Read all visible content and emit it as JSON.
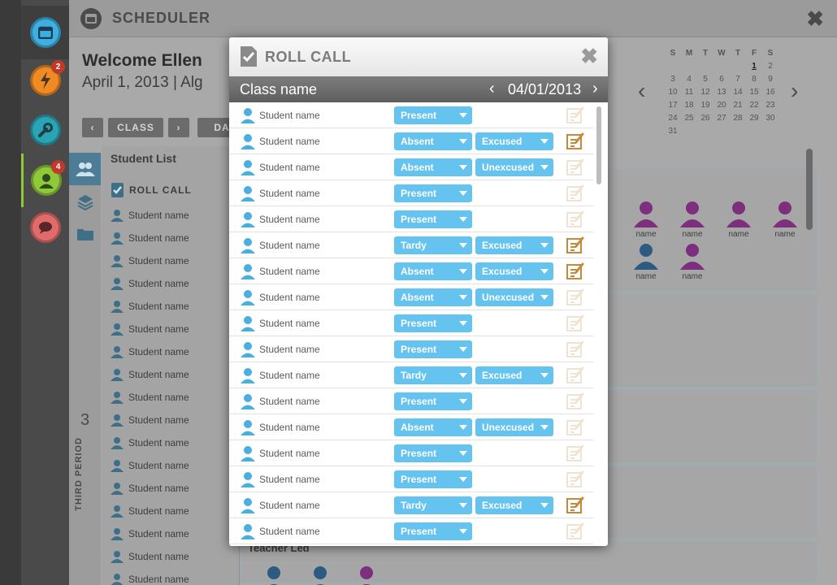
{
  "sidebar": {
    "items": [
      {
        "name": "calendar",
        "color": "#3db0e0",
        "badge": ""
      },
      {
        "name": "alerts",
        "color": "#f08a24",
        "badge": "2"
      },
      {
        "name": "tools",
        "color": "#2aa3b5",
        "badge": ""
      },
      {
        "name": "users",
        "color": "#8fc93a",
        "badge": "4"
      },
      {
        "name": "chat",
        "color": "#e06b6b",
        "badge": ""
      }
    ]
  },
  "app": {
    "title": "SCHEDULER",
    "close": "✖",
    "welcome": "Welcome Ellen",
    "date_line": "April 1, 2013  |  Alg",
    "nav": {
      "prev": "‹",
      "class_label": "CLASS",
      "next": "›",
      "day_label": "DA"
    },
    "period_num": "3",
    "period_text": "THIRD PERIOD",
    "student_list": {
      "title": "Student List",
      "roll_call": "ROLL CALL",
      "items": [
        "Student name",
        "Student name",
        "Student name",
        "Student name",
        "Student name",
        "Student name",
        "Student name",
        "Student name",
        "Student name",
        "Student name",
        "Student name",
        "Student name",
        "Student name",
        "Student name",
        "Student name",
        "Student name",
        "Student name"
      ]
    },
    "calendar": {
      "weekdays": [
        "S",
        "M",
        "T",
        "W",
        "T",
        "F",
        "S"
      ],
      "weeks": [
        [
          "",
          "",
          "",
          "",
          "",
          "1",
          "2"
        ],
        [
          "3",
          "4",
          "5",
          "6",
          "7",
          "8",
          "9"
        ],
        [
          "10",
          "11",
          "12",
          "13",
          "14",
          "15",
          "16"
        ],
        [
          "17",
          "18",
          "19",
          "20",
          "21",
          "22",
          "23"
        ],
        [
          "24",
          "25",
          "26",
          "27",
          "28",
          "29",
          "30"
        ],
        [
          "31",
          "",
          "",
          "",
          "",
          "",
          ""
        ]
      ],
      "prev": "‹",
      "next": "›"
    },
    "grid_names": [
      "name",
      "name",
      "name",
      "name",
      "name",
      "name"
    ],
    "teacher_led": "Teacher Led"
  },
  "modal": {
    "title": "ROLL CALL",
    "close": "✖",
    "class_name": "Class name",
    "date": "04/01/2013",
    "date_prev": "‹",
    "date_next": "›",
    "colors": {
      "dropdown": "#65c3f0",
      "note_active": "#c48a3c",
      "note_inactive": "#f1e2d2",
      "avatar": "#4aaee0"
    },
    "rows": [
      {
        "name": "Student name",
        "status": "Present",
        "reason": "",
        "note_active": false
      },
      {
        "name": "Student name",
        "status": "Absent",
        "reason": "Excused",
        "note_active": true
      },
      {
        "name": "Student name",
        "status": "Absent",
        "reason": "Unexcused",
        "note_active": false
      },
      {
        "name": "Student name",
        "status": "Present",
        "reason": "",
        "note_active": false
      },
      {
        "name": "Student name",
        "status": "Present",
        "reason": "",
        "note_active": false
      },
      {
        "name": "Student name",
        "status": "Tardy",
        "reason": "Excused",
        "note_active": true
      },
      {
        "name": "Student name",
        "status": "Absent",
        "reason": "Excused",
        "note_active": true
      },
      {
        "name": "Student name",
        "status": "Absent",
        "reason": "Unexcused",
        "note_active": false
      },
      {
        "name": "Student name",
        "status": "Present",
        "reason": "",
        "note_active": false
      },
      {
        "name": "Student name",
        "status": "Present",
        "reason": "",
        "note_active": false
      },
      {
        "name": "Student name",
        "status": "Tardy",
        "reason": "Excused",
        "note_active": false
      },
      {
        "name": "Student name",
        "status": "Present",
        "reason": "",
        "note_active": false
      },
      {
        "name": "Student name",
        "status": "Absent",
        "reason": "Unexcused",
        "note_active": false
      },
      {
        "name": "Student name",
        "status": "Present",
        "reason": "",
        "note_active": false
      },
      {
        "name": "Student name",
        "status": "Present",
        "reason": "",
        "note_active": false
      },
      {
        "name": "Student name",
        "status": "Tardy",
        "reason": "Excused",
        "note_active": true
      },
      {
        "name": "Student name",
        "status": "Present",
        "reason": "",
        "note_active": false
      }
    ]
  }
}
